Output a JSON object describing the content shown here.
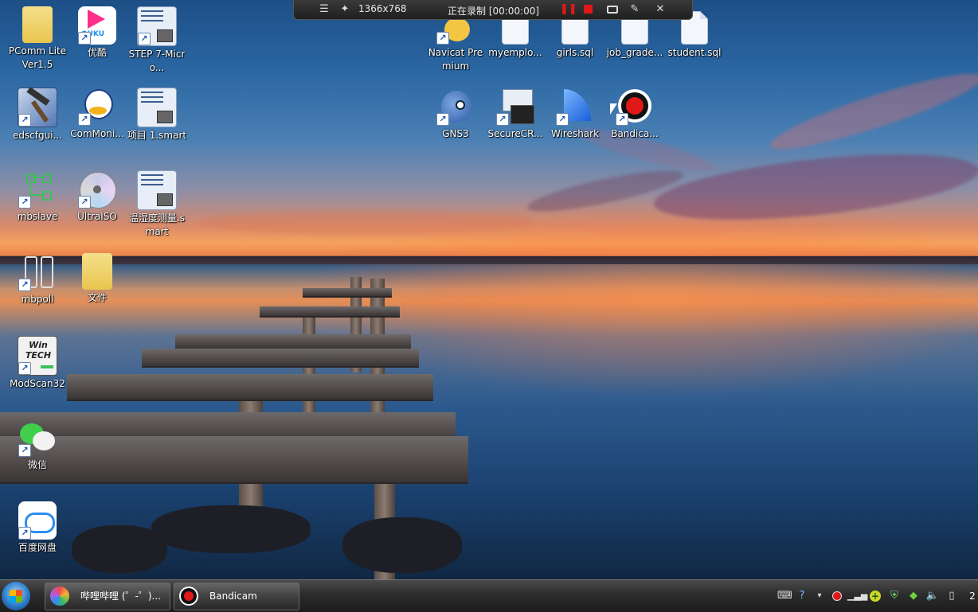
{
  "recorder": {
    "resolution": "1366x768",
    "status": "正在录制 [00:00:00]"
  },
  "desktop_icons": [
    {
      "label": "PComm Lite Ver1.5"
    },
    {
      "label": "优酷"
    },
    {
      "label": "STEP 7-Micro..."
    },
    {
      "label": "edscfgui..."
    },
    {
      "label": "ComMoni..."
    },
    {
      "label": "项目 1.smart"
    },
    {
      "label": "mbslave"
    },
    {
      "label": "UltraISO"
    },
    {
      "label": "温湿度测量.smart"
    },
    {
      "label": "mbpoll"
    },
    {
      "label": "文件"
    },
    {
      "label": "ModScan32"
    },
    {
      "label": "微信"
    },
    {
      "label": "百度网盘"
    },
    {
      "label": "Navicat Premium"
    },
    {
      "label": "myemplo..."
    },
    {
      "label": "girls.sql"
    },
    {
      "label": "job_grade..."
    },
    {
      "label": "student.sql"
    },
    {
      "label": "GNS3"
    },
    {
      "label": "SecureCR..."
    },
    {
      "label": "Wireshark"
    },
    {
      "label": "Bandica..."
    }
  ],
  "youku_text": "OUKU",
  "modscan_text": "Win TECH",
  "taskbar": {
    "items": [
      {
        "label": "哔哩哔哩 (゜-゜)..."
      },
      {
        "label": "Bandicam"
      }
    ],
    "clock_partial": "2"
  },
  "colors": {
    "record_red": "#e01818",
    "taskbar_dark": "#1c1c1c",
    "sky_blue": "#2a66a2",
    "sunset_orange": "#f6a25c"
  }
}
